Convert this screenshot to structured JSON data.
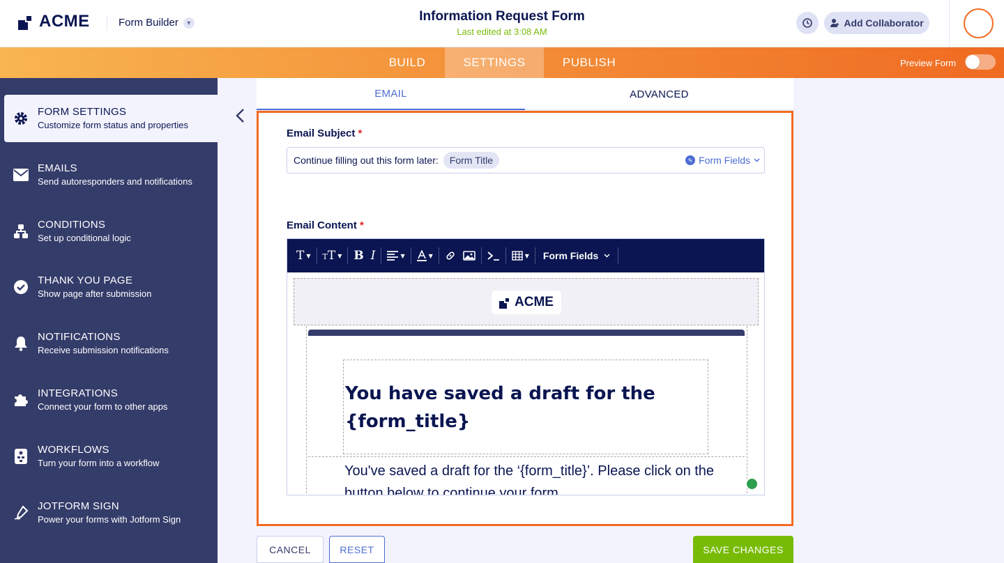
{
  "header": {
    "brand": "ACME",
    "builder_label": "Form Builder",
    "form_title": "Information Request Form",
    "last_edited": "Last edited at 3:08 AM",
    "add_collaborator": "Add Collaborator"
  },
  "nav": {
    "tabs": [
      {
        "label": "BUILD"
      },
      {
        "label": "SETTINGS"
      },
      {
        "label": "PUBLISH"
      }
    ],
    "preview_label": "Preview Form"
  },
  "sidebar": {
    "items": [
      {
        "title": "FORM SETTINGS",
        "subtitle": "Customize form status and properties"
      },
      {
        "title": "EMAILS",
        "subtitle": "Send autoresponders and notifications"
      },
      {
        "title": "CONDITIONS",
        "subtitle": "Set up conditional logic"
      },
      {
        "title": "THANK YOU PAGE",
        "subtitle": "Show page after submission"
      },
      {
        "title": "NOTIFICATIONS",
        "subtitle": "Receive submission notifications"
      },
      {
        "title": "INTEGRATIONS",
        "subtitle": "Connect your form to other apps"
      },
      {
        "title": "WORKFLOWS",
        "subtitle": "Turn your form into a workflow"
      },
      {
        "title": "JOTFORM SIGN",
        "subtitle": "Power your forms with Jotform Sign"
      }
    ]
  },
  "subtabs": {
    "email": "EMAIL",
    "advanced": "ADVANCED"
  },
  "email": {
    "subject_label": "Email Subject",
    "required_mark": "*",
    "subject_text": "Continue filling out this form later:",
    "subject_pill": "Form Title",
    "form_fields_link": "Form Fields",
    "content_label": "Email Content",
    "toolbar_form_fields": "Form Fields",
    "preview_brand": "ACME",
    "preview_heading": "You have saved a draft for the {form_title}",
    "preview_body": "You've saved a draft for the ‘{form_title}’. Please click on the button below to continue your form."
  },
  "actions": {
    "cancel": "CANCEL",
    "reset": "RESET",
    "save": "SAVE CHANGES"
  }
}
